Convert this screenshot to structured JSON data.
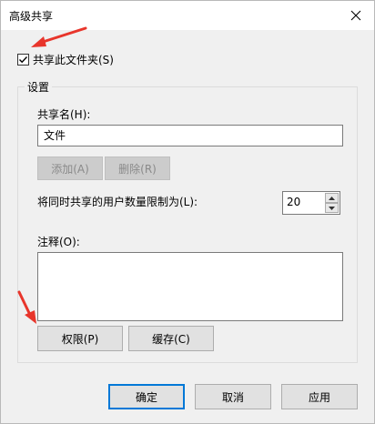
{
  "window": {
    "title": "高级共享"
  },
  "share_checkbox": {
    "label": "共享此文件夹(S)",
    "checked": true
  },
  "settings": {
    "group_label": "设置",
    "share_name_label": "共享名(H):",
    "share_name_value": "文件",
    "add_label": "添加(A)",
    "delete_label": "删除(R)",
    "user_limit_label": "将同时共享的用户数量限制为(L):",
    "user_limit_value": "20",
    "comment_label": "注释(O):",
    "comment_value": "",
    "permissions_label": "权限(P)",
    "caching_label": "缓存(C)"
  },
  "footer": {
    "ok_label": "确定",
    "cancel_label": "取消",
    "apply_label": "应用"
  },
  "colors": {
    "annotation_arrow": "#e8352b",
    "default_button_border": "#0078d7"
  }
}
